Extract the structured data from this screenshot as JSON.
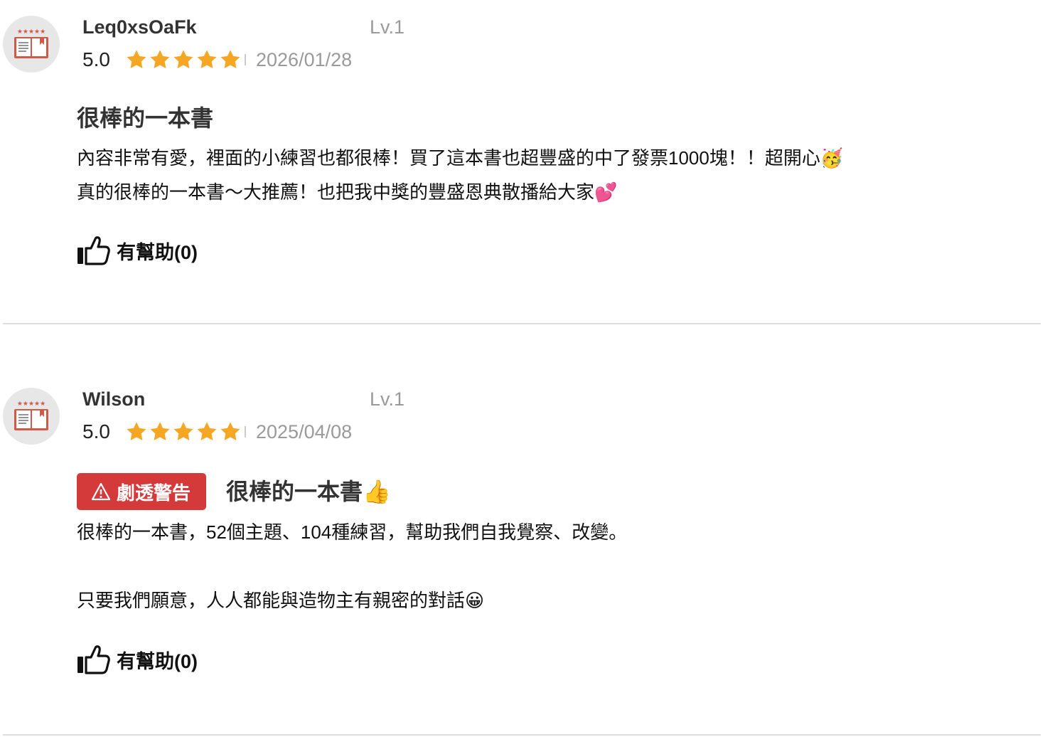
{
  "reviews": [
    {
      "username": "Leq0xsOaFk",
      "level": "Lv.1",
      "score": "5.0",
      "rating": 5,
      "date": "2026/01/28",
      "title": "很棒的一本書",
      "spoiler": "",
      "body": "內容非常有愛，裡面的小練習也都很棒！買了這本書也超豐盛的中了發票1000塊！！超開心🥳\n真的很棒的一本書～大推薦！也把我中獎的豐盛恩典散播給大家💕",
      "helpful_label": "有幫助(0)"
    },
    {
      "username": "Wilson",
      "level": "Lv.1",
      "score": "5.0",
      "rating": 5,
      "date": "2025/04/08",
      "title": "很棒的一本書👍",
      "spoiler": "劇透警告",
      "body": "很棒的一本書，52個主題、104種練習，幫助我們自我覺察、改變。\n\n只要我們願意，人人都能與造物主有親密的對話😀",
      "helpful_label": "有幫助(0)"
    }
  ],
  "colors": {
    "star": "#f5a623",
    "spoiler_bg": "#d43a3a",
    "muted_text": "#9a9a9a",
    "divider": "#dedede"
  },
  "icons": {
    "avatar": "book-avatar-icon",
    "star": "star-icon",
    "thumbs_up": "thumbs-up-icon",
    "warning": "warning-icon"
  }
}
